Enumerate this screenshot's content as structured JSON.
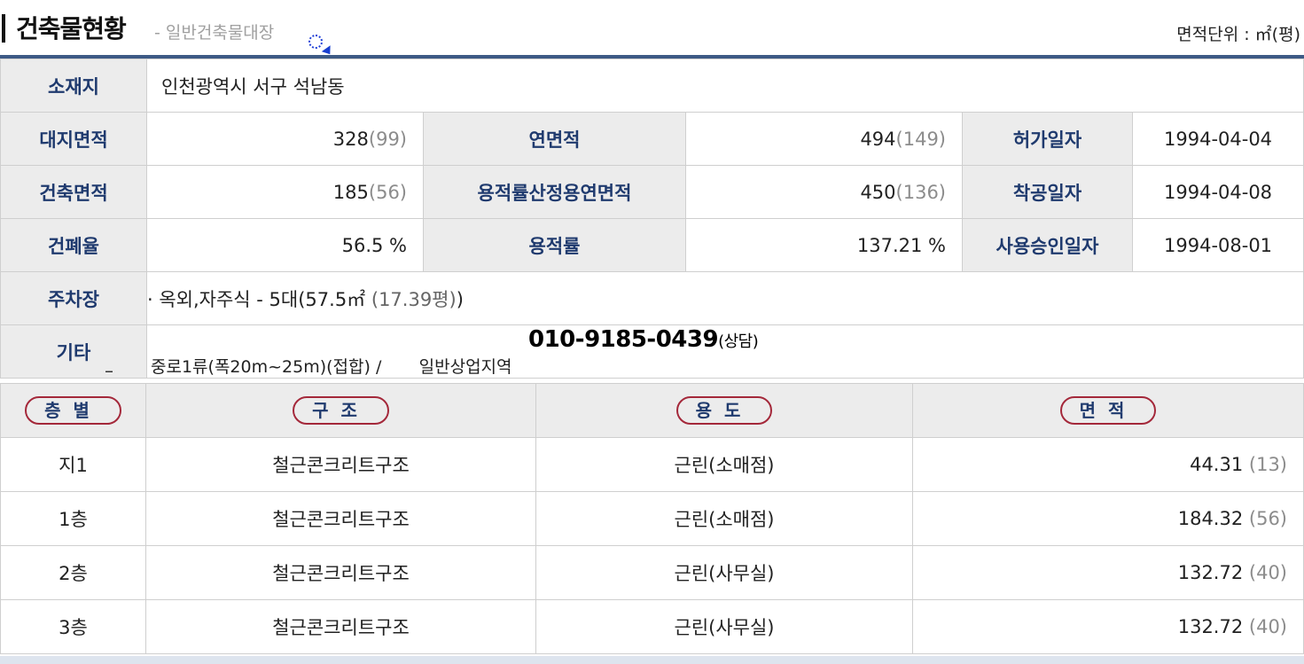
{
  "header": {
    "title": "건축물현황",
    "subtitle": "- 일반건축물대장",
    "unit_label": "면적단위 : ㎡(평)"
  },
  "info": {
    "location_label": "소재지",
    "location_value": "인천광역시 서구 석남동",
    "land_area_label": "대지면적",
    "land_area": "328",
    "land_area_py": "(99)",
    "total_floor_area_label": "연면적",
    "total_floor_area": "494",
    "total_floor_area_py": "(149)",
    "permit_date_label": "허가일자",
    "permit_date": "1994-04-04",
    "building_area_label": "건축면적",
    "building_area": "185",
    "building_area_py": "(56)",
    "far_floor_area_label": "용적률산정용연면적",
    "far_floor_area": "450",
    "far_floor_area_py": "(136)",
    "start_date_label": "착공일자",
    "start_date": "1994-04-08",
    "coverage_label": "건폐율",
    "coverage": "56.5 %",
    "far_label": "용적률",
    "far": "137.21 %",
    "approval_date_label": "사용승인일자",
    "approval_date": "1994-08-01",
    "parking_label": "주차장",
    "parking_main": "· 옥외,자주식 - 5대(57.5㎡",
    "parking_py": "(17.39평)",
    "parking_close": ")",
    "etc_label": "기타",
    "etc_dash": "_",
    "phone": "010-9185-0439",
    "phone_sub": "(상담)",
    "zone_text": "중로1류(폭20m~25m)(접합) /       일반상업지역"
  },
  "floors": {
    "headers": [
      "층별",
      "구조",
      "용도",
      "면적"
    ],
    "rows": [
      {
        "floor": "지1",
        "structure": "철근콘크리트구조",
        "use": "근린(소매점)",
        "area": "44.31",
        "py": "(13)"
      },
      {
        "floor": "1층",
        "structure": "철근콘크리트구조",
        "use": "근린(소매점)",
        "area": "184.32",
        "py": "(56)"
      },
      {
        "floor": "2층",
        "structure": "철근콘크리트구조",
        "use": "근린(사무실)",
        "area": "132.72",
        "py": "(40)"
      },
      {
        "floor": "3층",
        "structure": "철근콘크리트구조",
        "use": "근린(사무실)",
        "area": "132.72",
        "py": "(40)"
      }
    ]
  },
  "colors": {
    "label_text": "#1f3a6e",
    "label_bg": "#ececec",
    "rule": "#3d5a85",
    "oval_border": "#a4283a"
  }
}
